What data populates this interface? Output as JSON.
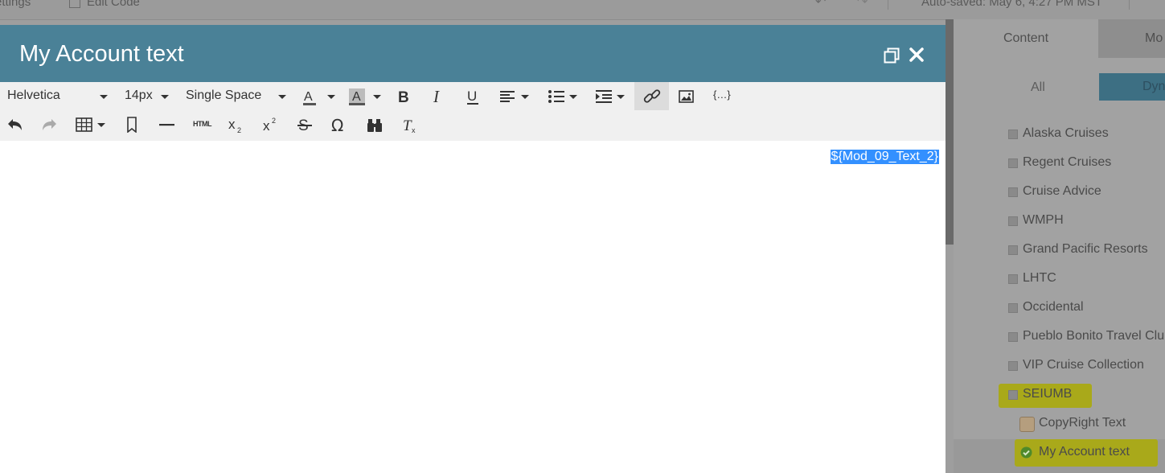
{
  "background": {
    "topbar": {
      "settings_label": "ettings",
      "edit_code_label": "Edit Code",
      "autosaved_text": "Auto-saved: May 6, 4:27 PM MST"
    }
  },
  "right_panel": {
    "tabs": [
      {
        "label": "Content"
      },
      {
        "label": "Mo"
      }
    ],
    "filters": {
      "all_label": "All",
      "dynamic_label": "Dynam"
    },
    "items": [
      {
        "label": "Alaska Cruises"
      },
      {
        "label": "Regent Cruises"
      },
      {
        "label": "Cruise Advice"
      },
      {
        "label": "WMPH"
      },
      {
        "label": "Grand Pacific Resorts"
      },
      {
        "label": "LHTC"
      },
      {
        "label": "Occidental"
      },
      {
        "label": "Pueblo Bonito Travel Clu"
      },
      {
        "label": "VIP Cruise Collection"
      },
      {
        "label": "SEIUMB"
      }
    ],
    "sub_items": [
      {
        "label": "CopyRight Text"
      },
      {
        "label": "My Account text"
      }
    ],
    "highlight_color": "#b6b62a"
  },
  "modal": {
    "title": "My Account text",
    "header_color": "#4a8197",
    "toolbar": {
      "font_family": "Helvetica",
      "font_size": "14px",
      "line_spacing": "Single Space",
      "html_label": "HTML"
    },
    "editor": {
      "content_token": "${Mod_09_Text_2}",
      "selection_color": "#3390ff"
    }
  }
}
